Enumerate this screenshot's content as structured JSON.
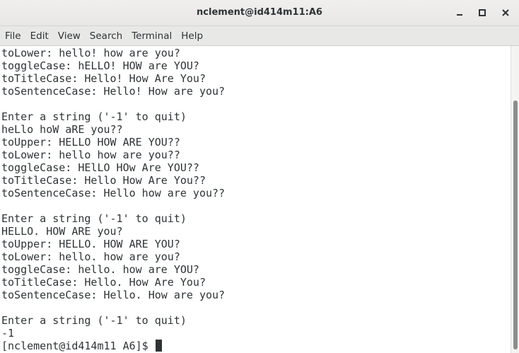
{
  "window": {
    "title": "nclement@id414m11:A6",
    "controls": [
      "minimize-icon",
      "maximize-icon",
      "close-icon"
    ]
  },
  "menubar": {
    "items": [
      {
        "label": "File"
      },
      {
        "label": "Edit"
      },
      {
        "label": "View"
      },
      {
        "label": "Search"
      },
      {
        "label": "Terminal"
      },
      {
        "label": "Help"
      }
    ]
  },
  "terminal": {
    "lines": [
      "toLower: hello! how are you?",
      "toggleCase: hELLO! HOW are YOU?",
      "toTitleCase: Hello! How Are You?",
      "toSentenceCase: Hello! How are you?",
      "",
      "Enter a string ('-1' to quit)",
      "heLlo hoW aRE you??",
      "toUpper: HELLO HOW ARE YOU??",
      "toLower: hello how are you??",
      "toggleCase: HElLO HOw Are YOU??",
      "toTitleCase: Hello How Are You??",
      "toSentenceCase: Hello how are you??",
      "",
      "Enter a string ('-1' to quit)",
      "HELLO. HOW ARE you?",
      "toUpper: HELLO. HOW ARE YOU?",
      "toLower: hello. how are you?",
      "toggleCase: hello. how are YOU?",
      "toTitleCase: Hello. How Are You?",
      "toSentenceCase: Hello. How are you?",
      "",
      "Enter a string ('-1' to quit)",
      "-1"
    ],
    "prompt": "[nclement@id414m11 A6]$ "
  }
}
